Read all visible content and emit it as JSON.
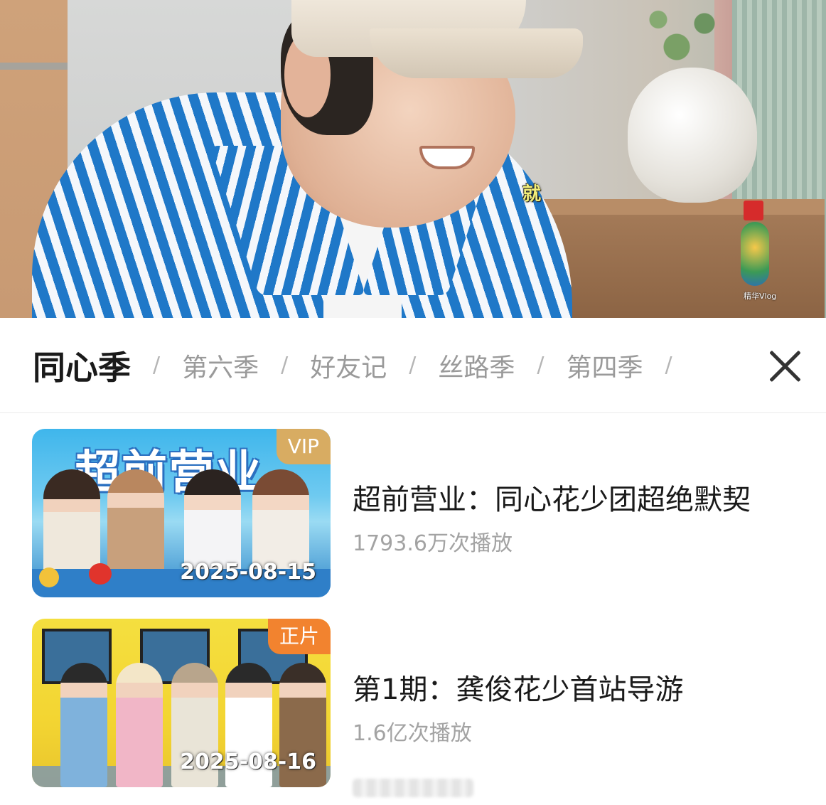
{
  "video": {
    "subtitle": "就",
    "watermark": "精华Vlog"
  },
  "seasons": {
    "tabs": [
      {
        "label": "同心季",
        "active": true
      },
      {
        "label": "第六季",
        "active": false
      },
      {
        "label": "好友记",
        "active": false
      },
      {
        "label": "丝路季",
        "active": false
      },
      {
        "label": "第四季",
        "active": false
      }
    ],
    "separator": "/",
    "close_icon": "close-icon"
  },
  "episodes": [
    {
      "title": "超前营业：同心花少团超绝默契",
      "plays": "1793.6万次播放",
      "badge": "VIP",
      "badge_color": "#d8ac62",
      "date": "2025-08-15",
      "thumb_title": "超前营业"
    },
    {
      "title": "第1期：龚俊花少首站导游",
      "plays": "1.6亿次播放",
      "badge": "正片",
      "badge_color": "#f2832f",
      "date": "2025-08-16"
    }
  ]
}
